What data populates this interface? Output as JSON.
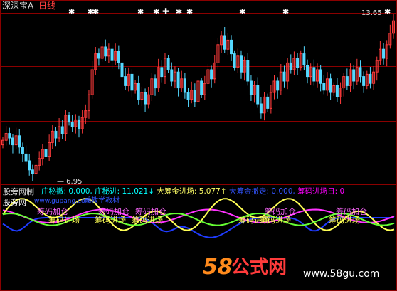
{
  "header": {
    "title": "深深宝A",
    "period": "日线",
    "price_top": "13.65"
  },
  "indicator": {
    "name": "股旁网制",
    "labels": [
      {
        "text": "庄秘撤: 0.000,",
        "color": "#00ffff"
      },
      {
        "text": "庄秘进: 11.021↓",
        "color": "#00ffff"
      },
      {
        "text": "大筹金进场: 5.077↑",
        "color": "#ffff66"
      },
      {
        "text": "大筹金撤走: 0.000,",
        "color": "#3355ff"
      },
      {
        "text": "筹码进场日: 0",
        "color": "#ff00ff"
      }
    ],
    "site_label": "股旁网",
    "site_url": "www.gupang.com",
    "ad_tail": "成教学教材"
  },
  "annotations": {
    "jiacang": "筹码加仓",
    "jinchang": "筹码进场"
  },
  "watermark": {
    "brand_num": "58",
    "brand_text": "公式网",
    "url": "www.58gu.com"
  },
  "colors": {
    "up": "#ff3b3b",
    "down": "#54d8ff",
    "grid": "#8b0000",
    "yellow": "#ffff55",
    "magenta": "#ff33ff",
    "green": "#66ff33",
    "blue": "#1f3bff",
    "hline": "#ffff00"
  },
  "chart_data": [
    {
      "type": "candlestick",
      "title": "深深宝A 日线",
      "price_labels": {
        "high": 13.65,
        "low": 6.95
      },
      "ylim": [
        6.5,
        14.0
      ],
      "close": [
        8.4,
        8.7,
        8.5,
        8.2,
        8.6,
        8.1,
        7.8,
        7.5,
        7.1,
        6.95,
        7.3,
        7.6,
        8.0,
        7.7,
        8.3,
        8.8,
        8.5,
        9.0,
        8.7,
        9.5,
        9.2,
        9.0,
        9.3,
        8.9,
        9.4,
        9.7,
        10.4,
        11.5,
        12.2,
        12.0,
        12.5,
        12.1,
        12.4,
        11.9,
        12.3,
        11.8,
        11.2,
        10.8,
        11.3,
        10.6,
        10.9,
        10.2,
        10.5,
        10.0,
        10.4,
        11.1,
        10.7,
        11.6,
        11.2,
        12.0,
        11.5,
        11.0,
        11.4,
        10.7,
        11.1,
        10.5,
        10.2,
        10.6,
        10.1,
        11.0,
        10.4,
        10.9,
        11.5,
        11.1,
        11.8,
        12.6,
        13.0,
        12.4,
        12.8,
        12.2,
        11.6,
        12.1,
        11.4,
        11.9,
        11.0,
        10.4,
        10.8,
        10.0,
        9.6,
        10.3,
        9.8,
        10.5,
        11.0,
        10.6,
        11.4,
        11.0,
        11.8,
        11.5,
        12.0,
        11.6,
        12.2,
        11.7,
        11.2,
        11.6,
        11.0,
        11.5,
        10.9,
        10.6,
        11.1,
        10.5,
        10.8,
        10.3,
        10.7,
        11.2,
        10.8,
        11.5,
        11.0,
        11.6,
        11.2,
        10.8,
        11.3,
        10.9,
        11.4,
        11.9,
        12.4,
        12.0,
        12.6,
        13.1,
        13.65
      ]
    },
    {
      "type": "line",
      "title": "股旁网制",
      "ylim": [
        -1.7,
        1.2
      ],
      "series": [
        {
          "name": "庄秘进",
          "color": "#ffff55"
        },
        {
          "name": "大筹金进场",
          "color": "#66ff33"
        },
        {
          "name": "筹码进场日",
          "color": "#ff33ff"
        },
        {
          "name": "大筹金撤走",
          "color": "#1f3bff"
        }
      ],
      "markers": [
        "筹码加仓",
        "筹码进场"
      ]
    }
  ]
}
